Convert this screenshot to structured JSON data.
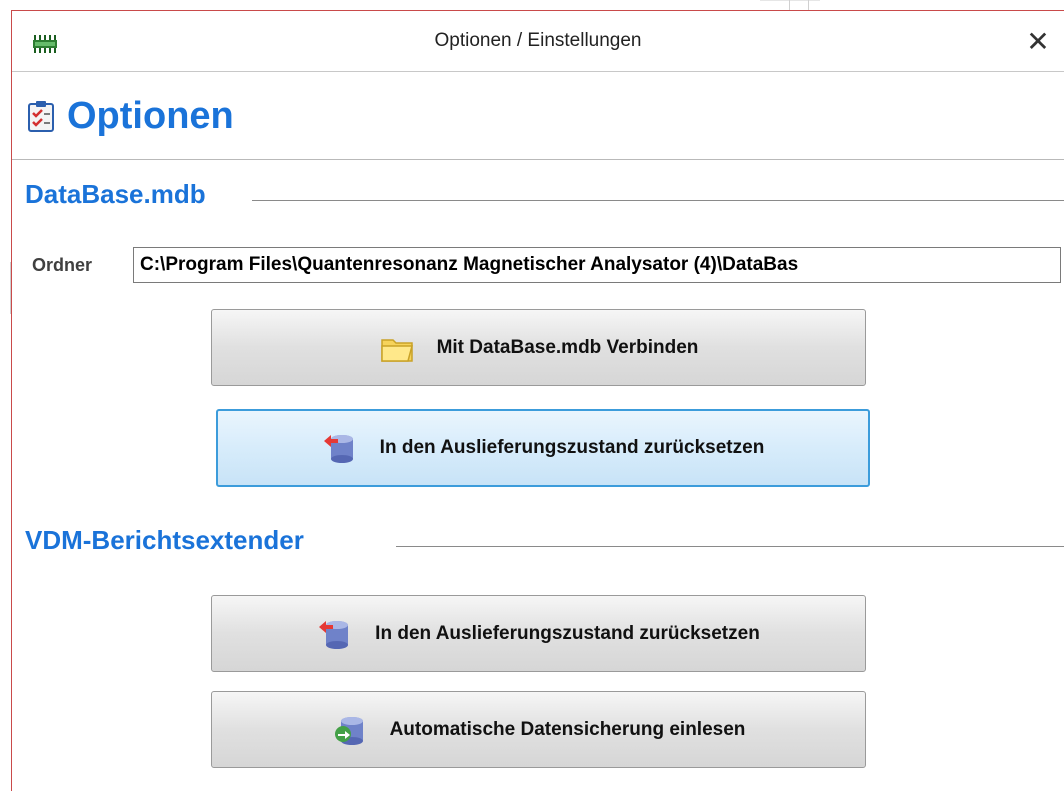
{
  "window": {
    "title": "Optionen / Einstellungen",
    "close_glyph": "✕",
    "app_icon": "green-circuit-icon"
  },
  "header": {
    "title": "Optionen",
    "icon": "checklist-icon"
  },
  "database_section": {
    "title": "DataBase.mdb",
    "folder_label": "Ordner",
    "folder_value": "C:\\Program Files\\Quantenresonanz Magnetischer Analysator (4)\\DataBas",
    "connect_button": {
      "label": "Mit DataBase.mdb Verbinden",
      "icon": "folder-icon"
    },
    "reset_button": {
      "label": "In den Auslieferungszustand zurücksetzen",
      "icon": "database-reset-icon"
    }
  },
  "vdm_section": {
    "title": "VDM-Berichtsextender",
    "reset_button": {
      "label": "In den Auslieferungszustand zurücksetzen",
      "icon": "database-reset-icon"
    },
    "restore_button": {
      "label": "Automatische Datensicherung einlesen",
      "icon": "database-restore-icon"
    }
  },
  "colors": {
    "accent": "#1a73d9",
    "frame": "#c94a4a",
    "focus": "#3c9cdb"
  }
}
